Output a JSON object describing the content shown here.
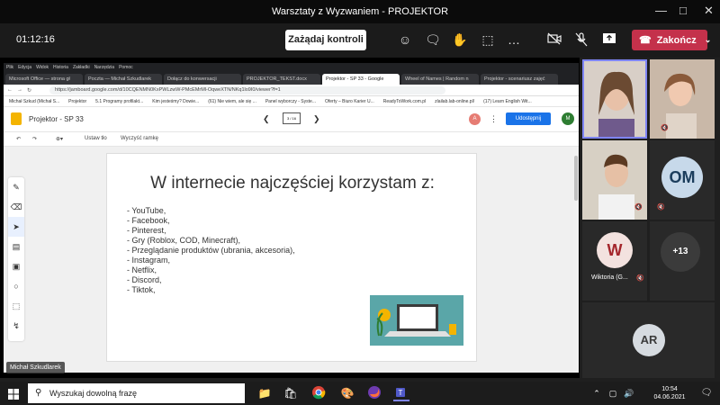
{
  "window": {
    "title": "Warsztaty z Wyzwaniem - PROJEKTOR"
  },
  "meeting": {
    "timer": "01:12:16",
    "control_label": "Zażądaj kontroli",
    "leave_label": "Zakończ"
  },
  "browser": {
    "menu": [
      "Plik",
      "Edycja",
      "Widok",
      "Historia",
      "Zakładki",
      "Narzędzia",
      "Pomoc"
    ],
    "tabs": [
      {
        "label": "Microsoft Office — strona gł"
      },
      {
        "label": "Poczta — Michał Szkudlarek"
      },
      {
        "label": "Dołącz do konwersacji"
      },
      {
        "label": "PROJEKTOR_TEKST.docx"
      },
      {
        "label": "Projektor - SP 33 - Google"
      },
      {
        "label": "Wheel of Names | Random n"
      },
      {
        "label": "Projektor - scenariusz zajęć"
      }
    ],
    "url": "https://jamboard.google.com/d/10CQENMN0KxPWLzwW-PMcEMrMl-OqweXTN/NKq1lo9I0/viewer?f=1",
    "bookmarks": [
      "Michał Szkud (Michał S...",
      "Projektor",
      "5.1 Programy profilakt...",
      "Kim jesteśmy? Dowie...",
      "(61) Nie wiem, ale się ...",
      "Panel wyborczy - Syste...",
      "Oferty – Biuro Karier U...",
      "ReadyToWork.com.pl",
      "zlailab.lab-online.pl/",
      "(17) Learn English Wit..."
    ]
  },
  "jamboard": {
    "title": "Projektor - SP 33",
    "frame_indicator": "3 / 16",
    "avatar_a": "A",
    "share_label": "Udostępnij",
    "avatar_m": "M",
    "set_background": "Ustaw tło",
    "clear_frame": "Wyczyść ramkę",
    "heading": "W internecie najczęściej korzystam z:",
    "items": [
      "- YouTube,",
      "- Facebook,",
      "- Pinterest,",
      "- Gry (Roblox, COD, Minecraft),",
      "- Przeglądanie produktów (ubrania, akcesoria),",
      "- Instagram,",
      "- Netflix,",
      "- Discord,",
      "- Tiktok,"
    ]
  },
  "presenter": {
    "name": "Michał Szkudlarek"
  },
  "participants": {
    "om_initials": "OM",
    "w_initial": "W",
    "w_name": "Wiktoria (G...",
    "more_count": "+13",
    "ar_initials": "AR",
    "colors": {
      "om_bg": "#c7d9ea",
      "w_bg": "#f3e2df",
      "w_text": "#a4262c",
      "ar_bg": "#d6dbe0"
    }
  },
  "taskbar": {
    "search_placeholder": "Wyszukaj dowolną frazę",
    "time": "10:54",
    "date": "04.06.2021"
  },
  "icons": [
    "windows-start-icon",
    "search-icon",
    "task-view-icon",
    "file-explorer-icon",
    "store-icon",
    "chrome-icon",
    "paint-icon",
    "firefox-icon",
    "teams-icon"
  ]
}
